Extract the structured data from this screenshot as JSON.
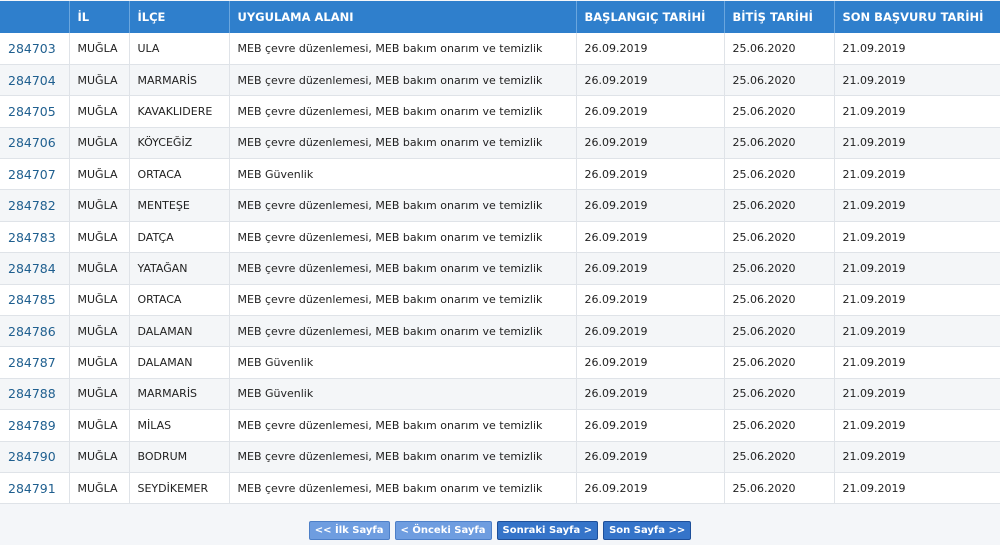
{
  "table": {
    "headers": [
      "",
      "İL",
      "İLÇE",
      "UYGULAMA ALANI",
      "BAŞLANGIÇ TARİHİ",
      "BİTİŞ TARİHİ",
      "SON BAŞVURU TARİHİ"
    ],
    "rows": [
      [
        "284703",
        "MUĞLA",
        "ULA",
        "MEB çevre düzenlemesi, MEB bakım onarım ve temizlik",
        "26.09.2019",
        "25.06.2020",
        "21.09.2019"
      ],
      [
        "284704",
        "MUĞLA",
        "MARMARİS",
        "MEB çevre düzenlemesi, MEB bakım onarım ve temizlik",
        "26.09.2019",
        "25.06.2020",
        "21.09.2019"
      ],
      [
        "284705",
        "MUĞLA",
        "KAVAKLIDERE",
        "MEB çevre düzenlemesi, MEB bakım onarım ve temizlik",
        "26.09.2019",
        "25.06.2020",
        "21.09.2019"
      ],
      [
        "284706",
        "MUĞLA",
        "KÖYCEĞİZ",
        "MEB çevre düzenlemesi, MEB bakım onarım ve temizlik",
        "26.09.2019",
        "25.06.2020",
        "21.09.2019"
      ],
      [
        "284707",
        "MUĞLA",
        "ORTACA",
        "MEB Güvenlik",
        "26.09.2019",
        "25.06.2020",
        "21.09.2019"
      ],
      [
        "284782",
        "MUĞLA",
        "MENTEŞE",
        "MEB çevre düzenlemesi, MEB bakım onarım ve temizlik",
        "26.09.2019",
        "25.06.2020",
        "21.09.2019"
      ],
      [
        "284783",
        "MUĞLA",
        "DATÇA",
        "MEB çevre düzenlemesi, MEB bakım onarım ve temizlik",
        "26.09.2019",
        "25.06.2020",
        "21.09.2019"
      ],
      [
        "284784",
        "MUĞLA",
        "YATAĞAN",
        "MEB çevre düzenlemesi, MEB bakım onarım ve temizlik",
        "26.09.2019",
        "25.06.2020",
        "21.09.2019"
      ],
      [
        "284785",
        "MUĞLA",
        "ORTACA",
        "MEB çevre düzenlemesi, MEB bakım onarım ve temizlik",
        "26.09.2019",
        "25.06.2020",
        "21.09.2019"
      ],
      [
        "284786",
        "MUĞLA",
        "DALAMAN",
        "MEB çevre düzenlemesi, MEB bakım onarım ve temizlik",
        "26.09.2019",
        "25.06.2020",
        "21.09.2019"
      ],
      [
        "284787",
        "MUĞLA",
        "DALAMAN",
        "MEB Güvenlik",
        "26.09.2019",
        "25.06.2020",
        "21.09.2019"
      ],
      [
        "284788",
        "MUĞLA",
        "MARMARİS",
        "MEB Güvenlik",
        "26.09.2019",
        "25.06.2020",
        "21.09.2019"
      ],
      [
        "284789",
        "MUĞLA",
        "MİLAS",
        "MEB çevre düzenlemesi, MEB bakım onarım ve temizlik",
        "26.09.2019",
        "25.06.2020",
        "21.09.2019"
      ],
      [
        "284790",
        "MUĞLA",
        "BODRUM",
        "MEB çevre düzenlemesi, MEB bakım onarım ve temizlik",
        "26.09.2019",
        "25.06.2020",
        "21.09.2019"
      ],
      [
        "284791",
        "MUĞLA",
        "SEYDİKEMER",
        "MEB çevre düzenlemesi, MEB bakım onarım ve temizlik",
        "26.09.2019",
        "25.06.2020",
        "21.09.2019"
      ]
    ]
  },
  "pager": {
    "first": "<< İlk Sayfa",
    "prev": "< Önceki Sayfa",
    "next": "Sonraki Sayfa >",
    "last": "Son Sayfa >>"
  },
  "colors": {
    "header_bg": "#2f7fcc",
    "link": "#1f5f8f",
    "pager_bg": "#3574c9"
  }
}
